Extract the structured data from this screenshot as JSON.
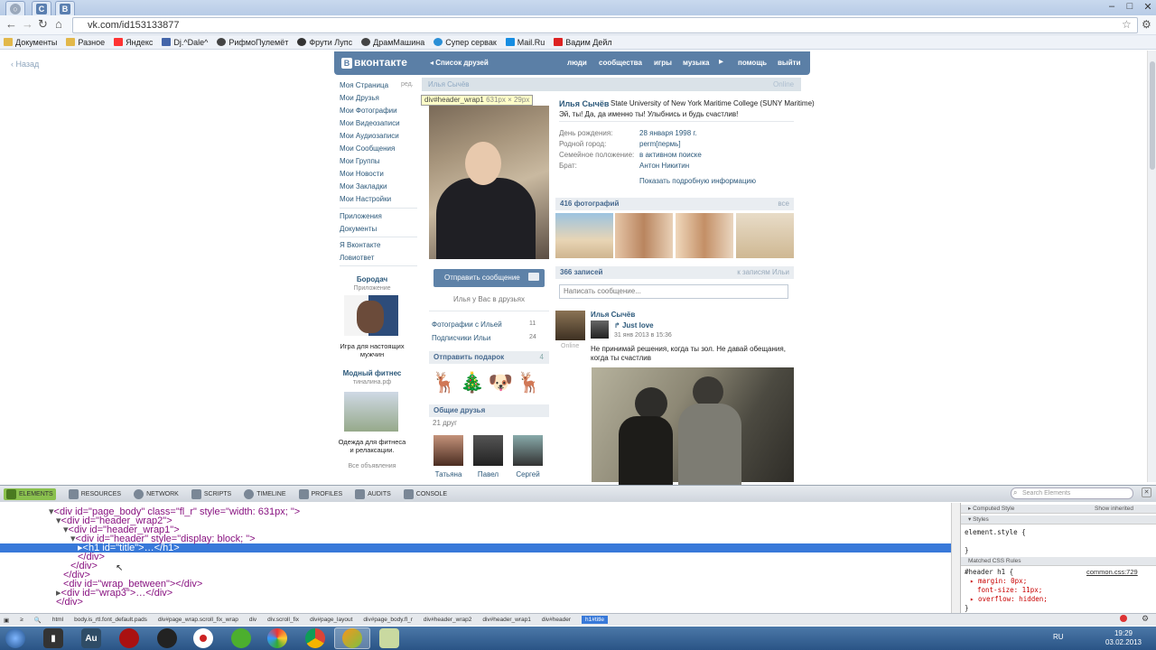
{
  "browser": {
    "tabs": [
      "С",
      "В"
    ],
    "url": "vk.com/id153133877",
    "bookmarks": [
      "Документы",
      "Разное",
      "Яндекс",
      "Dj.^Dale^",
      "РифмоПулемёт",
      "Фрути Лупс",
      "ДрамМашина",
      "Супер сервак",
      "Mail.Ru",
      "Вадим Дейл"
    ],
    "back_link": "Назад"
  },
  "vk": {
    "logo": "вконтакте",
    "friends_list": "Список друзей",
    "top_links": [
      "люди",
      "сообщества",
      "игры",
      "музыка",
      "помощь",
      "выйти"
    ],
    "sidebar": [
      "Моя Страница",
      "Мои Друзья",
      "Мои Фотографии",
      "Мои Видеозаписи",
      "Мои Аудиозаписи",
      "Мои Сообщения",
      "Мои Группы",
      "Мои Новости",
      "Мои Закладки",
      "Мои Настройки"
    ],
    "edit": "ред.",
    "sidebar2": [
      "Приложения",
      "Документы"
    ],
    "sidebar3": [
      "Я Вконтакте",
      "Ловиответ"
    ],
    "ad1": {
      "title": "Бородач",
      "sub": "Приложение",
      "text": "Игра для настоящих мужчин"
    },
    "ad2": {
      "title": "Модный фитнес",
      "sub": "тиналина.рф",
      "text": "Одежда для фитнеса и релаксации."
    },
    "all_ads": "Все объявления",
    "name_bar": "Илья Сычёв",
    "online": "Online",
    "tooltip_tag": "div#header_wrap1",
    "tooltip_size": "631px × 29px",
    "profile": {
      "name": "Илья Сычёв",
      "school": "State University of New York Maritime College (SUNY Maritime)",
      "status": "Эй, ты! Да, да именно ты! Улыбнись и будь счастлив!",
      "fields": [
        {
          "label": "День рождения:",
          "value": "28 января 1998 г."
        },
        {
          "label": "Родной город:",
          "value": "perm[пермь]"
        },
        {
          "label": "Семейное положение:",
          "value": "в активном поиске"
        },
        {
          "label": "Брат:",
          "value": "Антон Никитин"
        }
      ],
      "more": "Показать подробную информацию"
    },
    "send_msg": "Отправить сообщение",
    "in_friends": "Илья у Вас в друзьях",
    "photos_with": "Фотографии с Ильей",
    "photos_with_count": "11",
    "subscribers": "Подписчики Ильи",
    "subscribers_count": "24",
    "gift_title": "Отправить подарок",
    "gift_count": "4",
    "common_friends": "Общие друзья",
    "common_count": "21 друг",
    "friends": [
      "Татьяна",
      "Павел",
      "Сергей"
    ],
    "photos_title": "416 фотографий",
    "photos_all": "все",
    "wall_count": "366 записей",
    "wall_link": "к записям Ильи",
    "wall_placeholder": "Написать сообщение...",
    "post": {
      "author": "Илья Сычёв",
      "repost": "Just love",
      "date": "31 янв 2013 в 15:36",
      "online": "Online",
      "text": "Не принимай решения, когда ты зол. Не давай обещания, когда ты счастлив"
    }
  },
  "devtools": {
    "tabs": [
      "ELEMENTS",
      "RESOURCES",
      "NETWORK",
      "SCRIPTS",
      "TIMELINE",
      "PROFILES",
      "AUDITS",
      "CONSOLE"
    ],
    "search_placeholder": "Search Elements",
    "code": [
      "<div id=\"page_body\" class=\"fl_r\" style=\"width: 631px; \">",
      "<div id=\"header_wrap2\">",
      "<div id=\"header_wrap1\">",
      "<div id=\"header\" style=\"display: block; \">",
      "<h1 id=\"title\">…</h1>",
      "</div>",
      "</div>",
      "</div>",
      "<div id=\"wrap_between\"></div>",
      "<div id=\"wrap3\">…</div>",
      "</div>"
    ],
    "right": {
      "computed": "Computed Style",
      "show_inherited": "Show inherited",
      "styles": "Styles",
      "element_style": "element.style {",
      "close": "}",
      "matched": "Matched CSS Rules",
      "rule": "#header h1 {",
      "source": "common.css:729",
      "props": [
        "margin: 0px;",
        "font-size: 11px;",
        "overflow: hidden;"
      ]
    },
    "crumbs": [
      "html",
      "body.is_rtl.font_default.pads",
      "div#page_wrap.scroll_fix_wrap",
      "div",
      "div.scroll_fix",
      "div#page_layout",
      "div#page_body.fl_r",
      "div#header_wrap2",
      "div#header_wrap1",
      "div#header",
      "h1#title"
    ]
  },
  "taskbar": {
    "lang": "RU",
    "time": "19:29",
    "date": "03.02.2013"
  }
}
